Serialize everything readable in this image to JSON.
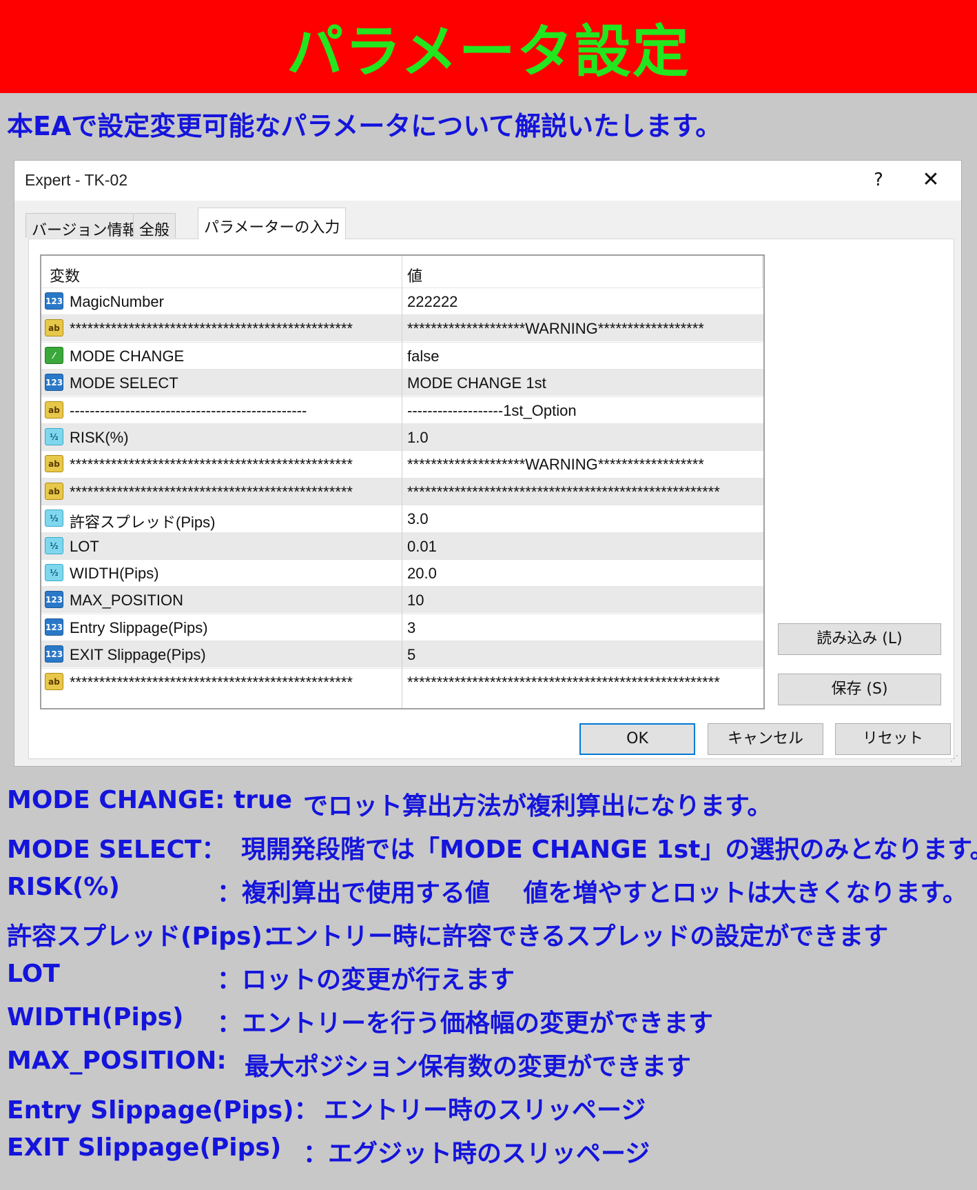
{
  "banner": {
    "title": "パラメータ設定"
  },
  "intro": "本EAで設定変更可能なパラメータについて解説いたします。",
  "dialog": {
    "title": "Expert - TK-02",
    "help": "?",
    "close": "✕",
    "tabs": [
      "バージョン情報",
      "全般",
      "パラメーターの入力"
    ],
    "active_tab": "パラメーターの入力",
    "columns": {
      "variable": "変数",
      "value": "値"
    },
    "rows": [
      {
        "type": "int",
        "icon": "123",
        "name": "MagicNumber",
        "value": "222222"
      },
      {
        "type": "str",
        "icon": "ab",
        "name": "************************************************",
        "value": "********************WARNING******************"
      },
      {
        "type": "bool",
        "icon": "⁄",
        "name": "MODE CHANGE",
        "value": "false"
      },
      {
        "type": "int",
        "icon": "123",
        "name": "MODE SELECT",
        "value": "MODE CHANGE 1st"
      },
      {
        "type": "str",
        "icon": "ab",
        "name": "-----------------------------------------------",
        "value": "-------------------1st_Option"
      },
      {
        "type": "dbl",
        "icon": "½",
        "name": "RISK(%)",
        "value": "1.0"
      },
      {
        "type": "str",
        "icon": "ab",
        "name": "************************************************",
        "value": "********************WARNING******************"
      },
      {
        "type": "str",
        "icon": "ab",
        "name": "************************************************",
        "value": "*****************************************************"
      },
      {
        "type": "dbl",
        "icon": "½",
        "name": "許容スプレッド(Pips)",
        "value": "3.0"
      },
      {
        "type": "dbl",
        "icon": "½",
        "name": "LOT",
        "value": "0.01"
      },
      {
        "type": "dbl",
        "icon": "½",
        "name": "WIDTH(Pips)",
        "value": "20.0"
      },
      {
        "type": "int",
        "icon": "123",
        "name": "MAX_POSITION",
        "value": "10"
      },
      {
        "type": "int",
        "icon": "123",
        "name": "Entry Slippage(Pips)",
        "value": "3"
      },
      {
        "type": "int",
        "icon": "123",
        "name": "EXIT Slippage(Pips)",
        "value": "5"
      },
      {
        "type": "str",
        "icon": "ab",
        "name": "************************************************",
        "value": "*****************************************************"
      }
    ],
    "buttons": {
      "load": "読み込み (L)",
      "save": "保存 (S)",
      "ok": "OK",
      "cancel": "キャンセル",
      "reset": "リセット"
    }
  },
  "notes": [
    {
      "key": "MODE CHANGE: true",
      "desc": "でロット算出方法が複利算出になります。"
    },
    {
      "key": "MODE SELECT：",
      "desc": "現開発段階では「MODE CHANGE 1st」の選択のみとなります。"
    },
    {
      "key": "RISK(%)",
      "desc": "：複利算出で使用する値　 値を増やすとロットは大きくなります。"
    },
    {
      "key": "許容スプレッド(Pips)：",
      "desc": "エントリー時に許容できるスプレッドの設定ができます"
    },
    {
      "key": "LOT",
      "desc": "：ロットの変更が行えます"
    },
    {
      "key": "WIDTH(Pips)",
      "desc": "：エントリーを行う価格幅の変更ができます"
    },
    {
      "key": "MAX_POSITION:",
      "desc": "最大ポジション保有数の変更ができます"
    },
    {
      "key": "Entry Slippage(Pips)：",
      "desc": "エントリー時のスリッページ"
    },
    {
      "key": "EXIT Slippage(Pips)",
      "desc": "：エグジット時のスリッページ"
    }
  ]
}
